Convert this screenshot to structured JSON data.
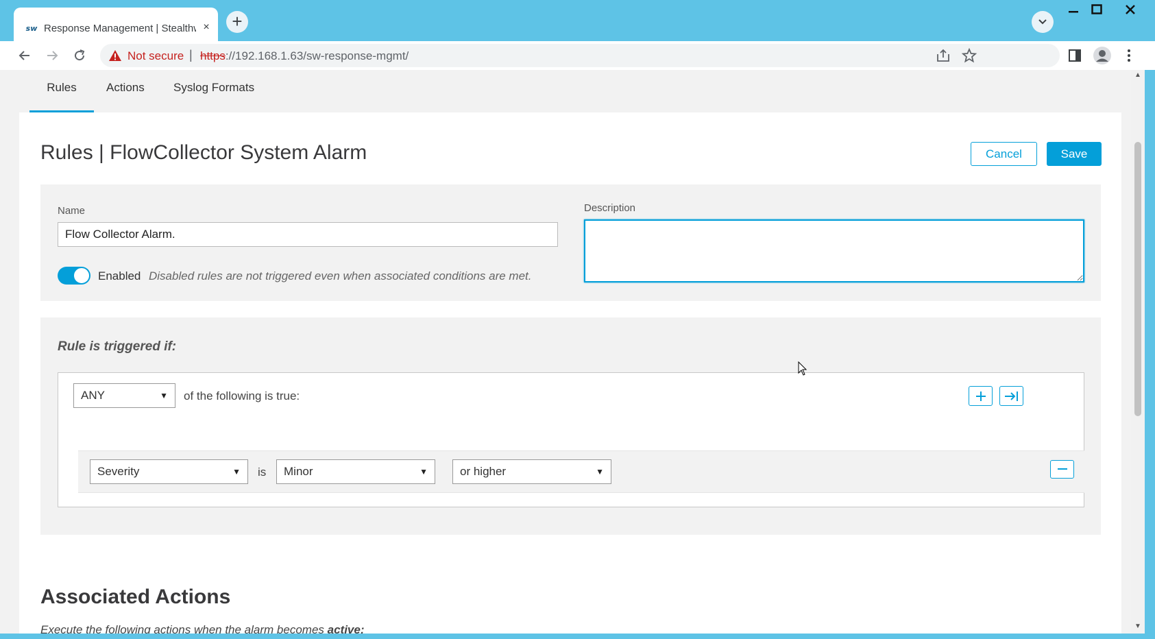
{
  "browser": {
    "tab_favicon": "sw",
    "tab_title": "Response Management | Stealthwatch",
    "tab_close_icon": "×",
    "new_tab_icon": "+",
    "security_label": "Not secure",
    "url_scheme": "https",
    "url_rest": "://192.168.1.63/sw-response-mgmt/",
    "window_controls": [
      "minimize",
      "maximize",
      "close"
    ]
  },
  "subnav": {
    "tabs": [
      {
        "label": "Rules",
        "active": true
      },
      {
        "label": "Actions",
        "active": false
      },
      {
        "label": "Syslog Formats",
        "active": false
      }
    ]
  },
  "header": {
    "title": "Rules | FlowCollector System Alarm",
    "cancel_label": "Cancel",
    "save_label": "Save"
  },
  "form": {
    "name_label": "Name",
    "name_value": "Flow Collector Alarm.",
    "description_label": "Description",
    "description_value": "",
    "enabled": true,
    "enabled_label": "Enabled",
    "enabled_help": "Disabled rules are not triggered even when associated conditions are met."
  },
  "rule": {
    "heading": "Rule is triggered if:",
    "match_select": "ANY",
    "match_text": "of the following is true:",
    "add_icon": "+",
    "nest_icon": "→|",
    "condition": {
      "field": "Severity",
      "operator_text": "is",
      "value": "Minor",
      "qualifier": "or higher",
      "remove_icon": "−"
    }
  },
  "actions_section": {
    "title": "Associated Actions",
    "subtitle_prefix": "Execute the following actions when the alarm becomes ",
    "subtitle_emphasis": "active:"
  },
  "colors": {
    "accent": "#049fd9",
    "chrome": "#5ec3e6",
    "page_bg": "#f2f2f2",
    "warning": "#c5221f"
  }
}
